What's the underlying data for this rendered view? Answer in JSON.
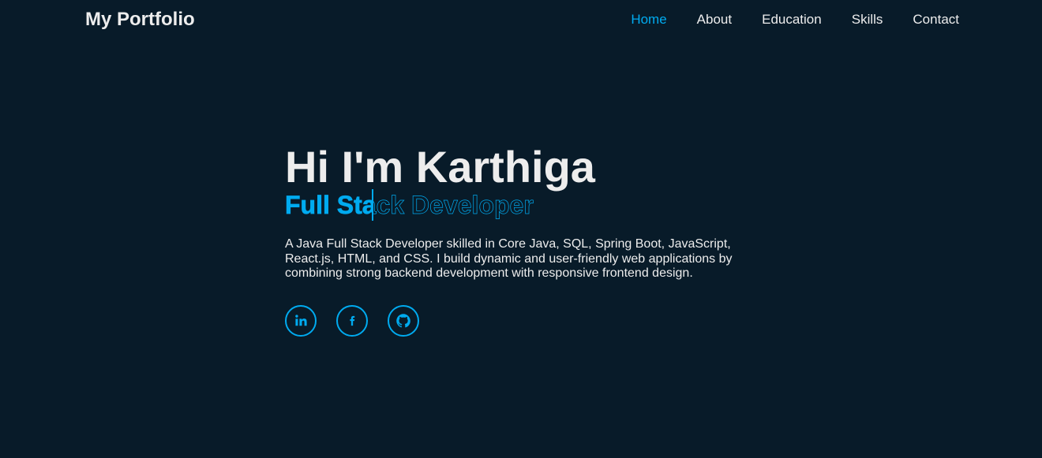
{
  "header": {
    "logo": "My Portfolio",
    "nav": [
      {
        "label": "Home",
        "active": true
      },
      {
        "label": "About",
        "active": false
      },
      {
        "label": "Education",
        "active": false
      },
      {
        "label": "Skills",
        "active": false
      },
      {
        "label": "Contact",
        "active": false
      }
    ]
  },
  "hero": {
    "title": "Hi I'm Karthiga",
    "role": "Full Stack Developer",
    "role_revealed": "Full Sta",
    "description": "A Java Full Stack Developer skilled in Core Java, SQL, Spring Boot, JavaScript, React.js, HTML, and CSS. I build dynamic and user-friendly web applications by combining strong backend development with responsive frontend design."
  },
  "social": [
    {
      "icon": "linkedin-icon"
    },
    {
      "icon": "facebook-icon"
    },
    {
      "icon": "github-icon"
    }
  ],
  "colors": {
    "background": "#081b29",
    "accent": "#00abf0",
    "text": "#ededed"
  }
}
